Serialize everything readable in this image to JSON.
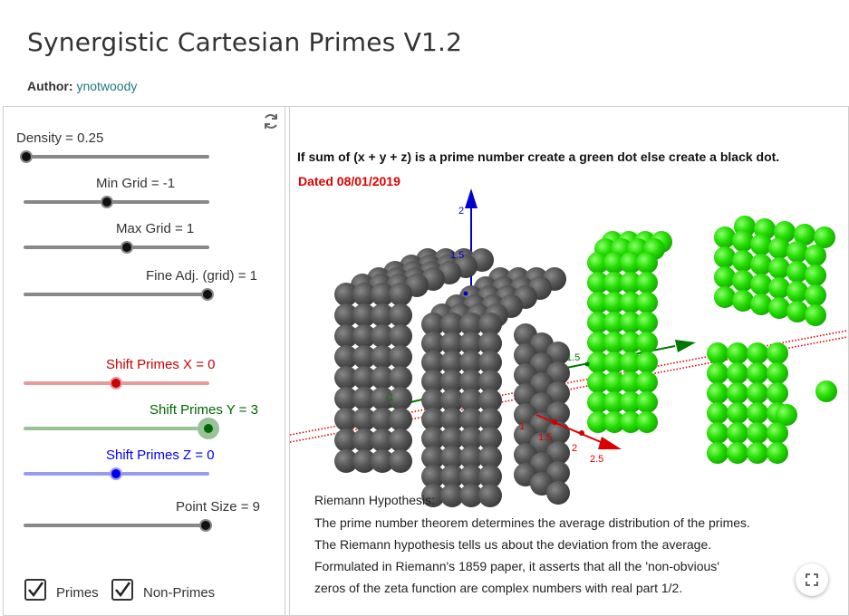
{
  "page": {
    "title": "Synergistic Cartesian Primes V1.2",
    "author_label": "Author:",
    "author_name": "ynotwoody"
  },
  "sliders": [
    {
      "id": "density",
      "label": "Density = 0.25",
      "color": "#222222",
      "value": 0.25
    },
    {
      "id": "min-grid",
      "label": "Min Grid = -1",
      "color": "#222222",
      "value": -1
    },
    {
      "id": "max-grid",
      "label": "Max Grid = 1",
      "color": "#222222",
      "value": 1
    },
    {
      "id": "fine-adj",
      "label": "Fine Adj. (grid) = 1",
      "color": "#222222",
      "value": 1
    },
    {
      "id": "shift-x",
      "label": "Shift Primes X = 0",
      "color": "#cc0000",
      "value": 0
    },
    {
      "id": "shift-y",
      "label": "Shift Primes Y = 3",
      "color": "#006600",
      "value": 3
    },
    {
      "id": "shift-z",
      "label": "Shift Primes Z = 0",
      "color": "#0000ff",
      "value": 0
    },
    {
      "id": "point-size",
      "label": "Point Size = 9",
      "color": "#222222",
      "value": 9
    }
  ],
  "checkboxes": [
    {
      "label": "Primes",
      "checked": true
    },
    {
      "label": "Non-Primes",
      "checked": true
    }
  ],
  "graphics": {
    "heading": "If sum of (x + y + z) is a prime number create a green dot else create a black dot.",
    "date": "Dated 08/01/2019",
    "riemann_title": "Riemann Hypothesis:",
    "riemann_lines": [
      "The prime number theorem determines the average distribution of the primes.",
      "The Riemann hypothesis tells us about the deviation from the average.",
      "Formulated in Riemann's 1859 paper, it asserts that all the 'non-obvious'",
      "zeros of the zeta function are complex numbers with real part 1/2."
    ],
    "axis_labels": {
      "z_2": "2",
      "z_1_5": "1.5",
      "y_1_5": "1.5",
      "y_neg1": "-1",
      "x_1": "1",
      "x_1_5": "1.5",
      "x_2": "2",
      "x_2_5": "2.5"
    }
  },
  "colors": {
    "prime": "#22dd00",
    "non_prime": "#555555",
    "x_axis": "#dd0000",
    "y_axis": "#007700",
    "z_axis": "#0000cc",
    "date": "#e00000"
  },
  "icons": {
    "refresh": "refresh-icon",
    "expand": "fullscreen-icon",
    "check": "checkmark-icon"
  }
}
